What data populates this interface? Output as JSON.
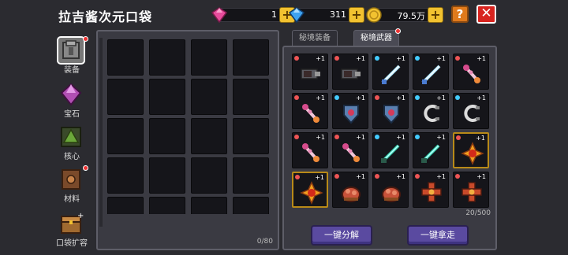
{
  "header": {
    "title": "拉吉酱次元口袋"
  },
  "resources": [
    {
      "name": "pink-gem",
      "value": "1",
      "color": "#e74c9c"
    },
    {
      "name": "blue-gem",
      "value": "311",
      "color": "#3fa3f0"
    },
    {
      "name": "gold-coin",
      "value": "79.5万",
      "color": "#f2c230"
    }
  ],
  "buttons": {
    "help": "?",
    "close": "✕",
    "plus": "+"
  },
  "sidebar": {
    "items": [
      {
        "label": "装备",
        "icon": "armor-icon"
      },
      {
        "label": "宝石",
        "icon": "gem-icon"
      },
      {
        "label": "核心",
        "icon": "core-icon"
      },
      {
        "label": "材料",
        "icon": "material-icon"
      },
      {
        "label": "口袋扩容",
        "icon": "chest-icon"
      }
    ]
  },
  "left_panel": {
    "count": "0/80"
  },
  "tabs": [
    {
      "label": "秘境装备"
    },
    {
      "label": "秘境武器"
    }
  ],
  "right_panel": {
    "count": "20/500",
    "qty": "+1",
    "items": [
      {
        "icon": "blaster-icon",
        "rarity": "#e55"
      },
      {
        "icon": "blaster-icon",
        "rarity": "#e55"
      },
      {
        "icon": "sword-icon",
        "rarity": "#4cf"
      },
      {
        "icon": "sword-icon",
        "rarity": "#4cf"
      },
      {
        "icon": "wand-icon",
        "rarity": "#e55"
      },
      {
        "icon": "wand-icon",
        "rarity": "#e55"
      },
      {
        "icon": "shield-icon",
        "rarity": "#4cf"
      },
      {
        "icon": "shield-icon",
        "rarity": "#e55"
      },
      {
        "icon": "claw-icon",
        "rarity": "#4cf"
      },
      {
        "icon": "claw-icon",
        "rarity": "#4cf"
      },
      {
        "icon": "wand-icon",
        "rarity": "#e55"
      },
      {
        "icon": "wand-icon",
        "rarity": "#e55"
      },
      {
        "icon": "dagger-icon",
        "rarity": "#4cf"
      },
      {
        "icon": "dagger-icon",
        "rarity": "#4cf"
      },
      {
        "icon": "amulet-icon",
        "rarity": "#e55"
      },
      {
        "icon": "amulet-icon",
        "rarity": "#e55"
      },
      {
        "icon": "basket-icon",
        "rarity": "#e55"
      },
      {
        "icon": "basket-icon",
        "rarity": "#e55"
      },
      {
        "icon": "cross-icon",
        "rarity": "#e55"
      },
      {
        "icon": "cross-icon",
        "rarity": "#e55"
      }
    ]
  },
  "actions": {
    "decompose": "一键分解",
    "take_all": "一键拿走"
  }
}
